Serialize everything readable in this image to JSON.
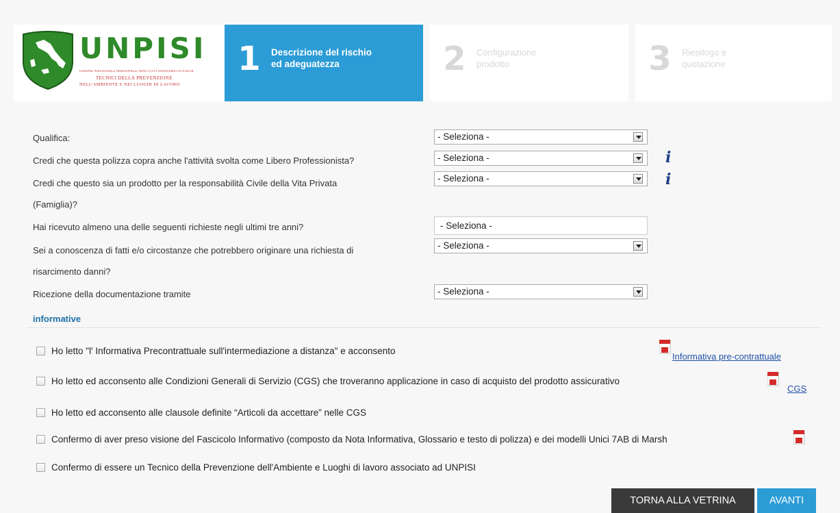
{
  "logo": {
    "title": "UNPISI",
    "tagline1": "UNIONE NAZIONALE PERSONALE ISPETTIVO SANITARIO D'ITALIA",
    "tagline2": "TECNICI DELLA PREVENZIONE",
    "tagline3": "NELL'AMBIENTE E NEI LUOGHI DI LAVORO",
    "colors": {
      "green": "#2f8a2a",
      "red": "#c23030"
    }
  },
  "steps": [
    {
      "number": "1",
      "label": "Descrizione del rischio\ned adeguatezza"
    },
    {
      "number": "2",
      "label": "Configurazione\nprodotto"
    },
    {
      "number": "3",
      "label": "Riepilogo e\nquotazione"
    }
  ],
  "form": {
    "rows": [
      {
        "label": "Qualifica:",
        "value": "- Seleziona -"
      },
      {
        "label": "Credi che questa polizza copra anche l'attività svolta come Libero Professionista?",
        "value": "- Seleziona -",
        "info": "i"
      },
      {
        "label": "Credi che questo sia un prodotto per la responsabilità Civile della Vita Privata",
        "label2": "(Famiglia)?",
        "value": "- Seleziona -",
        "info": "i"
      },
      {
        "label": "Hai ricevuto almeno una delle seguenti richieste negli ultimi tre anni?",
        "value": "- Seleziona -"
      },
      {
        "label": "Sei a conoscenza di fatti e/o circostanze che potrebbero originare una richiesta di",
        "label2": "risarcimento danni?",
        "value": "- Seleziona -"
      },
      {
        "label": "Ricezione della documentazione tramite",
        "value": "- Seleziona -"
      }
    ]
  },
  "informative": {
    "title": "informative",
    "checkboxes": [
      "Ho letto \"l' Informativa Precontrattuale sull'intermediazione a distanza\" e acconsento",
      "Ho letto ed acconsento alle Condizioni Generali di Servizio (CGS) che troveranno applicazione in caso di acquisto del prodotto assicurativo",
      "Ho letto ed acconsento alle clausole definite “Articoli da accettare” nelle CGS",
      "Confermo di aver preso visione del Fascicolo Informativo (composto da Nota Informativa, Glossario e testo di polizza) e dei modelli Unici 7AB di Marsh",
      "Confermo di essere un Tecnico della Prevenzione dell'Ambiente e Luoghi di lavoro associato ad UNPISI"
    ],
    "links": [
      {
        "label": "Informativa pre-contrattuale",
        "icon": "pdf-icon"
      },
      {
        "label": "CGS",
        "icon": "pdf-icon"
      }
    ]
  },
  "buttons": {
    "back": "TORNA ALLA VETRINA",
    "next": "AVANTI"
  },
  "colors": {
    "accent": "#2c9cd6",
    "dark_button": "#3a3a3a",
    "info_icon": "#1f3d8a",
    "section_title": "#1f6fa8"
  }
}
